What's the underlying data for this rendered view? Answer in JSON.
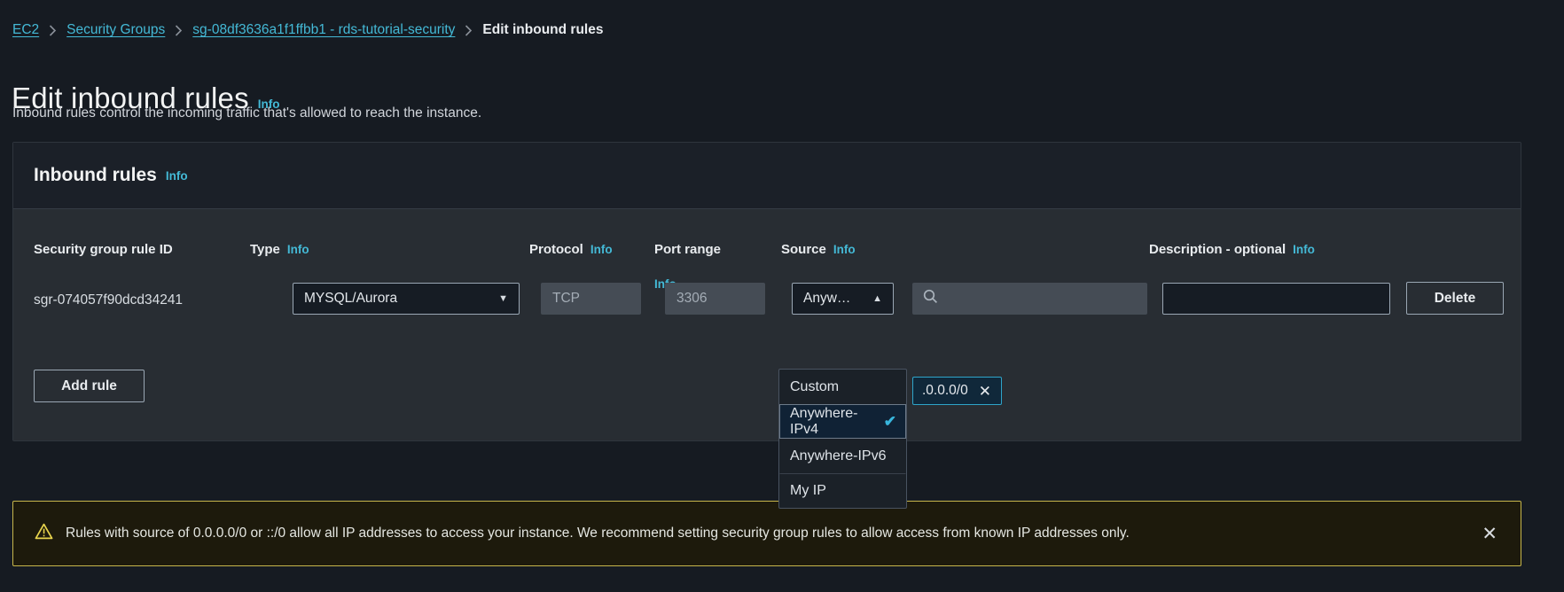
{
  "breadcrumb": {
    "items": [
      {
        "label": "EC2",
        "type": "link"
      },
      {
        "label": "Security Groups",
        "type": "link"
      },
      {
        "label": "sg-08df3636a1f1ffbb1 - rds-tutorial-security",
        "type": "link"
      },
      {
        "label": "Edit inbound rules",
        "type": "current"
      }
    ]
  },
  "page": {
    "title": "Edit inbound rules",
    "info_label": "Info",
    "description": "Inbound rules control the incoming traffic that's allowed to reach the instance."
  },
  "panel": {
    "heading": "Inbound rules",
    "heading_info": "Info",
    "columns": {
      "rule_id": "Security group rule ID",
      "type": "Type",
      "type_info": "Info",
      "protocol": "Protocol",
      "protocol_info": "Info",
      "port_range": "Port range",
      "port_range_info": "Info",
      "source": "Source",
      "source_info": "Info",
      "description": "Description - optional",
      "description_info": "Info"
    },
    "rule": {
      "id": "sgr-074057f90dcd34241",
      "type_value": "MYSQL/Aurora",
      "protocol_value": "TCP",
      "port_range_value": "3306",
      "source_value": "Anyw…",
      "source_search_placeholder": "",
      "source_token": ".0.0.0/0",
      "source_token_remove": "✕",
      "description_value": "",
      "delete_label": "Delete"
    },
    "add_rule_label": "Add rule"
  },
  "source_dropdown": {
    "expanded": true,
    "options": [
      {
        "label": "Custom",
        "selected": false,
        "divider_above": false
      },
      {
        "label": "Anywhere-IPv4",
        "selected": true,
        "divider_above": false
      },
      {
        "label": "Anywhere-IPv6",
        "selected": false,
        "divider_above": false
      },
      {
        "label": "My IP",
        "selected": false,
        "divider_above": true
      }
    ],
    "check_glyph": "✔"
  },
  "warning_banner": {
    "icon": "warning-triangle-icon",
    "text": "Rules with source of 0.0.0.0/0 or ::/0 allow all IP addresses to access your instance. We recommend setting security group rules to allow access from known IP addresses only.",
    "close_label": "✕"
  },
  "colors": {
    "page_background": "#161b22",
    "panel_background": "#282d33",
    "panel_header_background": "#1b2028",
    "link_accent": "#44b9d6",
    "warning_border": "#c6b64b",
    "warning_background": "#1d1a0c",
    "selected_option_background": "#102235",
    "token_border": "#2ea4c9"
  }
}
